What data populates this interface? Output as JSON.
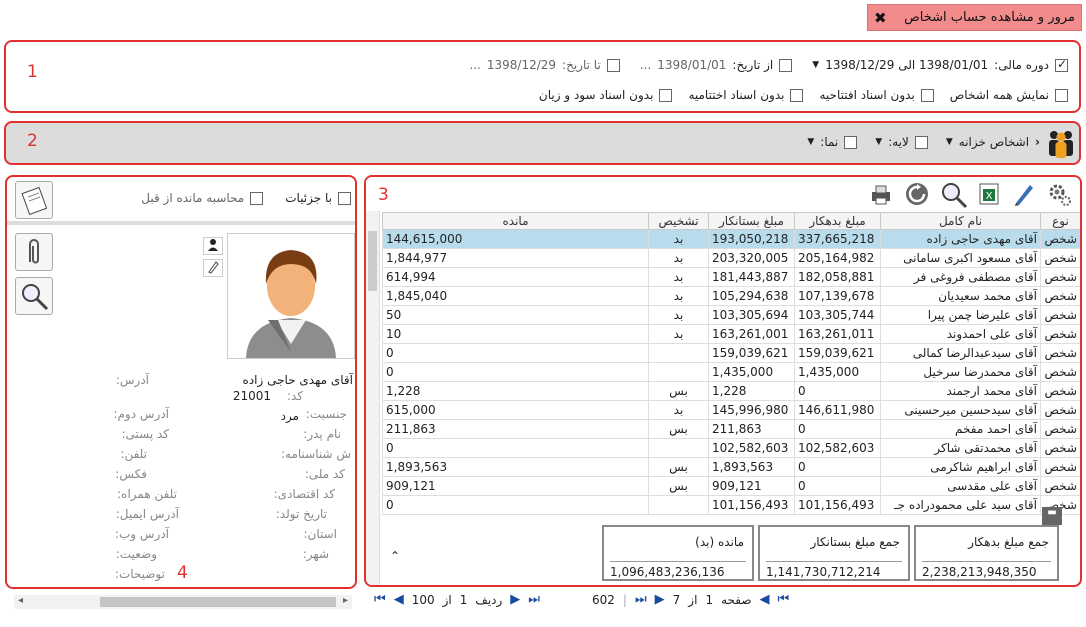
{
  "title": "مرور و مشاهده حساب اشخاص",
  "section_numbers": [
    "1",
    "2",
    "3",
    "4"
  ],
  "filters": {
    "fiscal_period_label": "دوره مالی:",
    "fiscal_period_value": "1398/01/01 الی 1398/12/29",
    "from_date_label": "از تاریخ:",
    "from_date_value": "1398/01/01",
    "to_date_label": "تا تاریخ:",
    "to_date_value": "1398/12/29",
    "ellipsis": "...",
    "show_all_label": "نمایش همه اشخاص",
    "no_opening_label": "بدون اسناد افتتاحیه",
    "no_closing_label": "بدون اسناد اختتامیه",
    "no_pl_label": "بدون اسناد سود و زیان"
  },
  "toolbar2": {
    "people_label": "اشخاص خزانه",
    "layer_label": "لایه:",
    "view_label": "نما:"
  },
  "grid": {
    "columns": [
      "نوع",
      "نام کامل",
      "مبلغ بدهکار",
      "مبلغ بستانکار",
      "تشخیص",
      "مانده"
    ],
    "rows": [
      [
        "شخص",
        "آقای مهدی حاجی زاده",
        "337,665,218",
        "193,050,218",
        "بد",
        "144,615,000"
      ],
      [
        "شخص",
        "آقای مسعود اکبری سامانی",
        "205,164,982",
        "203,320,005",
        "بد",
        "1,844,977"
      ],
      [
        "شخص",
        "آقای مصطفی فروغی فر",
        "182,058,881",
        "181,443,887",
        "بد",
        "614,994"
      ],
      [
        "شخص",
        "آقای محمد سعیدیان",
        "107,139,678",
        "105,294,638",
        "بد",
        "1,845,040"
      ],
      [
        "شخص",
        "آقای علیرضا چمن پیرا",
        "103,305,744",
        "103,305,694",
        "بد",
        "50"
      ],
      [
        "شخص",
        "آقای علی احمدوند",
        "163,261,011",
        "163,261,001",
        "بد",
        "10"
      ],
      [
        "شخص",
        "آقای سیدعبدالرضا کمالی",
        "159,039,621",
        "159,039,621",
        "",
        "0"
      ],
      [
        "شخص",
        "آقای محمدرضا سرخیل",
        "1,435,000",
        "1,435,000",
        "",
        "0"
      ],
      [
        "شخص",
        "آقای محمد ارجمند",
        "0",
        "1,228",
        "بس",
        "1,228"
      ],
      [
        "شخص",
        "آقای سیدحسین میرحسینی",
        "146,611,980",
        "145,996,980",
        "بد",
        "615,000"
      ],
      [
        "شخص",
        "آقای احمد مفخم",
        "0",
        "211,863",
        "بس",
        "211,863"
      ],
      [
        "شخص",
        "آقای محمدتقی شاکر",
        "102,582,603",
        "102,582,603",
        "",
        "0"
      ],
      [
        "شخص",
        "آقای ابراهیم شاکرمی",
        "0",
        "1,893,563",
        "بس",
        "1,893,563"
      ],
      [
        "شخص",
        "آقای علی مقدسی",
        "0",
        "909,121",
        "بس",
        "909,121"
      ],
      [
        "شخص",
        "آقای سید علی محمودراده جـ",
        "101,156,493",
        "101,156,493",
        "",
        "0"
      ]
    ]
  },
  "sums": {
    "debit_title": "جمع مبلغ بدهکار",
    "debit_value": "2,238,213,948,350",
    "credit_title": "جمع مبلغ بستانکار",
    "credit_value": "1,141,730,712,214",
    "balance_title": "مانده (بد)",
    "balance_value": "1,096,483,236,136"
  },
  "pager_main": {
    "count": "602",
    "page_label": "صفحه",
    "page": "1",
    "of_label": "از",
    "pages": "7"
  },
  "pager_side": {
    "row_label": "ردیف",
    "row": "1",
    "of_label": "از",
    "total": "100"
  },
  "details": {
    "with_details_label": "با جزئیات",
    "calc_prev_label": "محاسبه مانده از قبل",
    "name": "آقای مهدی حاجی زاده",
    "code_label": "کد:",
    "code": "21001",
    "gender_label": "جنسیت:",
    "gender": "مرد",
    "father_label": "نام پدر:",
    "id_label": "ش شناسنامه:",
    "national_label": "کد ملی:",
    "economic_label": "کد اقتصادی:",
    "birth_label": "تاریخ تولد:",
    "province_label": "استان:",
    "city_label": "شهر:",
    "address_label": "آدرس:",
    "address2_label": "آدرس دوم:",
    "postal_label": "کد پستی:",
    "phone_label": "تلفن:",
    "fax_label": "فکس:",
    "mobile_label": "تلفن همراه:",
    "email_label": "آدرس ایمیل:",
    "web_label": "آدرس وب:",
    "status_label": "وضعیت:",
    "notes_label": "توضیحات:"
  }
}
